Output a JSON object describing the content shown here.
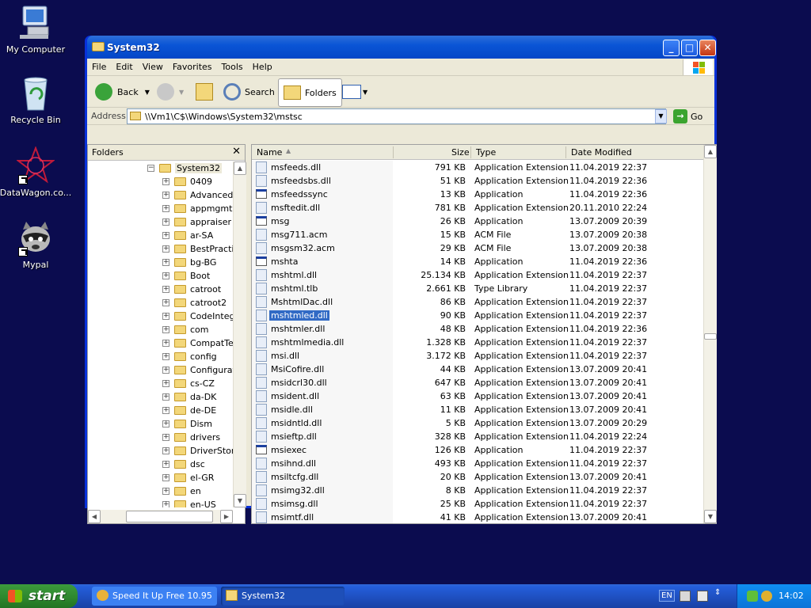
{
  "desktop": {
    "icons": [
      {
        "label": "My Computer",
        "icon": "my-computer-icon"
      },
      {
        "label": "Recycle Bin",
        "icon": "recycle-bin-icon"
      },
      {
        "label": "DataWagon.co...",
        "icon": "datawagon-icon"
      },
      {
        "label": "Mypal",
        "icon": "mypal-raccoon-icon"
      }
    ]
  },
  "window": {
    "title": "System32",
    "menu": [
      "File",
      "Edit",
      "View",
      "Favorites",
      "Tools",
      "Help"
    ],
    "toolbar": {
      "back": "Back",
      "search": "Search",
      "folders": "Folders"
    },
    "address": {
      "label": "Address",
      "value": "\\\\Vm1\\C$\\Windows\\System32\\mstsc",
      "go": "Go"
    },
    "folders_pane": {
      "header": "Folders",
      "root": "System32",
      "items": [
        "0409",
        "AdvancedI",
        "appmgmt",
        "appraiser",
        "ar-SA",
        "BestPractic",
        "bg-BG",
        "Boot",
        "catroot",
        "catroot2",
        "CodeIntegi",
        "com",
        "CompatTel",
        "config",
        "Configurati",
        "cs-CZ",
        "da-DK",
        "de-DE",
        "Dism",
        "drivers",
        "DriverStore",
        "dsc",
        "el-GR",
        "en",
        "en-US"
      ]
    },
    "columns": {
      "name": "Name",
      "size": "Size",
      "type": "Type",
      "date": "Date Modified"
    },
    "files": [
      {
        "name": "msfeeds.dll",
        "size": "791 KB",
        "type": "Application Extension",
        "date": "11.04.2019 22:37",
        "kind": "dll"
      },
      {
        "name": "msfeedsbs.dll",
        "size": "51 KB",
        "type": "Application Extension",
        "date": "11.04.2019 22:36",
        "kind": "dll"
      },
      {
        "name": "msfeedssync",
        "size": "13 KB",
        "type": "Application",
        "date": "11.04.2019 22:36",
        "kind": "app"
      },
      {
        "name": "msftedit.dll",
        "size": "781 KB",
        "type": "Application Extension",
        "date": "20.11.2010 22:24",
        "kind": "dll"
      },
      {
        "name": "msg",
        "size": "26 KB",
        "type": "Application",
        "date": "13.07.2009 20:39",
        "kind": "app"
      },
      {
        "name": "msg711.acm",
        "size": "15 KB",
        "type": "ACM File",
        "date": "13.07.2009 20:38",
        "kind": "acm"
      },
      {
        "name": "msgsm32.acm",
        "size": "29 KB",
        "type": "ACM File",
        "date": "13.07.2009 20:38",
        "kind": "acm"
      },
      {
        "name": "mshta",
        "size": "14 KB",
        "type": "Application",
        "date": "11.04.2019 22:36",
        "kind": "app"
      },
      {
        "name": "mshtml.dll",
        "size": "25.134 KB",
        "type": "Application Extension",
        "date": "11.04.2019 22:37",
        "kind": "dll"
      },
      {
        "name": "mshtml.tlb",
        "size": "2.661 KB",
        "type": "Type Library",
        "date": "11.04.2019 22:37",
        "kind": "tlb"
      },
      {
        "name": "MshtmlDac.dll",
        "size": "86 KB",
        "type": "Application Extension",
        "date": "11.04.2019 22:37",
        "kind": "dll"
      },
      {
        "name": "mshtmled.dll",
        "size": "90 KB",
        "type": "Application Extension",
        "date": "11.04.2019 22:37",
        "kind": "dll",
        "selected": true
      },
      {
        "name": "mshtmler.dll",
        "size": "48 KB",
        "type": "Application Extension",
        "date": "11.04.2019 22:36",
        "kind": "dll"
      },
      {
        "name": "mshtmlmedia.dll",
        "size": "1.328 KB",
        "type": "Application Extension",
        "date": "11.04.2019 22:37",
        "kind": "dll"
      },
      {
        "name": "msi.dll",
        "size": "3.172 KB",
        "type": "Application Extension",
        "date": "11.04.2019 22:37",
        "kind": "dll"
      },
      {
        "name": "MsiCofire.dll",
        "size": "44 KB",
        "type": "Application Extension",
        "date": "13.07.2009 20:41",
        "kind": "dll"
      },
      {
        "name": "msidcrl30.dll",
        "size": "647 KB",
        "type": "Application Extension",
        "date": "13.07.2009 20:41",
        "kind": "dll"
      },
      {
        "name": "msident.dll",
        "size": "63 KB",
        "type": "Application Extension",
        "date": "13.07.2009 20:41",
        "kind": "dll"
      },
      {
        "name": "msidle.dll",
        "size": "11 KB",
        "type": "Application Extension",
        "date": "13.07.2009 20:41",
        "kind": "dll"
      },
      {
        "name": "msidntld.dll",
        "size": "5 KB",
        "type": "Application Extension",
        "date": "13.07.2009 20:29",
        "kind": "dll"
      },
      {
        "name": "msieftp.dll",
        "size": "328 KB",
        "type": "Application Extension",
        "date": "11.04.2019 22:24",
        "kind": "dll"
      },
      {
        "name": "msiexec",
        "size": "126 KB",
        "type": "Application",
        "date": "11.04.2019 22:37",
        "kind": "app"
      },
      {
        "name": "msihnd.dll",
        "size": "493 KB",
        "type": "Application Extension",
        "date": "11.04.2019 22:37",
        "kind": "dll"
      },
      {
        "name": "msiltcfg.dll",
        "size": "20 KB",
        "type": "Application Extension",
        "date": "13.07.2009 20:41",
        "kind": "dll"
      },
      {
        "name": "msimg32.dll",
        "size": "8 KB",
        "type": "Application Extension",
        "date": "11.04.2019 22:37",
        "kind": "dll"
      },
      {
        "name": "msimsg.dll",
        "size": "25 KB",
        "type": "Application Extension",
        "date": "11.04.2019 22:37",
        "kind": "dll"
      },
      {
        "name": "msimtf.dll",
        "size": "41 KB",
        "type": "Application Extension",
        "date": "13.07.2009 20:41",
        "kind": "dll"
      }
    ]
  },
  "taskbar": {
    "start": "start",
    "buttons": [
      {
        "label": "Speed It Up Free 10.95",
        "active": false
      },
      {
        "label": "System32",
        "active": true
      }
    ],
    "language": "EN",
    "clock": "14:02"
  },
  "colors": {
    "desktop": "#0b0c4f",
    "selection": "#316ac5",
    "titlebar": "#0a55d6",
    "start": "#2f8a2f"
  }
}
